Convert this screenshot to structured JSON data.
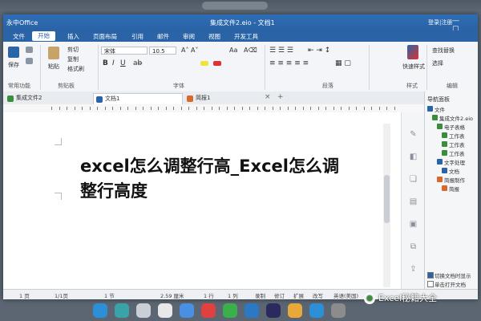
{
  "window": {
    "app_name": "永中Office",
    "doc_title": "集成文件2.eio - 文档1",
    "login": "登录|注册",
    "controls": "— ▢ ✕"
  },
  "menu": {
    "items": [
      "文件",
      "开始",
      "插入",
      "页面布局",
      "引用",
      "邮件",
      "审阅",
      "视图",
      "开发工具"
    ],
    "active_index": 1
  },
  "ribbon": {
    "save": "保存",
    "paste": "粘贴",
    "cut": "剪切",
    "copy": "复制",
    "format_painter": "格式刷",
    "font_name": "宋体",
    "font_size": "10.5",
    "quick_style": "快速样式",
    "find_replace": "查找替换",
    "select": "选择",
    "groups": {
      "common": "常用功能",
      "clipboard": "剪贴板",
      "font": "字体",
      "paragraph": "段落",
      "style": "样式",
      "edit": "编辑"
    }
  },
  "tabs": [
    {
      "label": "集成文件2",
      "active": false,
      "color": "#3a8d3a"
    },
    {
      "label": "文档1",
      "active": true,
      "color": "#2a63a6"
    },
    {
      "label": "简报1",
      "active": false,
      "color": "#d9682a"
    }
  ],
  "tab_controls": {
    "close": "×",
    "add": "+"
  },
  "document": {
    "heading_line1": "excel怎么调整行高_Excel怎么调",
    "heading_line2": "整行高度"
  },
  "nav_pane": {
    "title": "导航面板",
    "tree": [
      {
        "label": "文件",
        "level": 0,
        "color": "#2a63a6"
      },
      {
        "label": "集成文件2.eio",
        "level": 1,
        "color": "#3a8d3a"
      },
      {
        "label": "电子表格",
        "level": 2,
        "color": "#3a8d3a"
      },
      {
        "label": "工作表",
        "level": 3,
        "color": "#3a8d3a"
      },
      {
        "label": "工作表",
        "level": 3,
        "color": "#3a8d3a"
      },
      {
        "label": "工作表",
        "level": 3,
        "color": "#3a8d3a"
      },
      {
        "label": "文字处理",
        "level": 2,
        "color": "#2a63a6"
      },
      {
        "label": "文档",
        "level": 3,
        "color": "#2a63a6"
      },
      {
        "label": "简报制作",
        "level": 2,
        "color": "#d9682a"
      },
      {
        "label": "简报",
        "level": 3,
        "color": "#d9682a"
      }
    ],
    "switch_label": "切换文档时显示",
    "single_click_label": "单击打开文档"
  },
  "status": {
    "page": "1 页",
    "pages": "1/1页",
    "section": "1 节",
    "position": "2.59 厘米",
    "line": "1 行",
    "column": "1 列",
    "record": "录制",
    "revise": "修订",
    "extend": "扩展",
    "overtype": "改写",
    "language": "英语(美国)"
  },
  "dock": {
    "icons": [
      "browser-icon",
      "terminal-icon",
      "settings-icon",
      "calendar-icon",
      "appstore-icon",
      "media-icon",
      "files-icon",
      "vscode-icon",
      "ps-icon",
      "music-icon",
      "power-icon",
      "trash-icon"
    ],
    "colors": [
      "#2d8fd5",
      "#3aa3a8",
      "#c9cfd6",
      "#e8e8e8",
      "#4a90e2",
      "#e04040",
      "#3bb04a",
      "#2b78c4",
      "#2a2a5e",
      "#e8a93a",
      "#2d8fd5",
      "#8c8c8c"
    ]
  },
  "watermark": {
    "text": "Excel秘籍大全"
  }
}
